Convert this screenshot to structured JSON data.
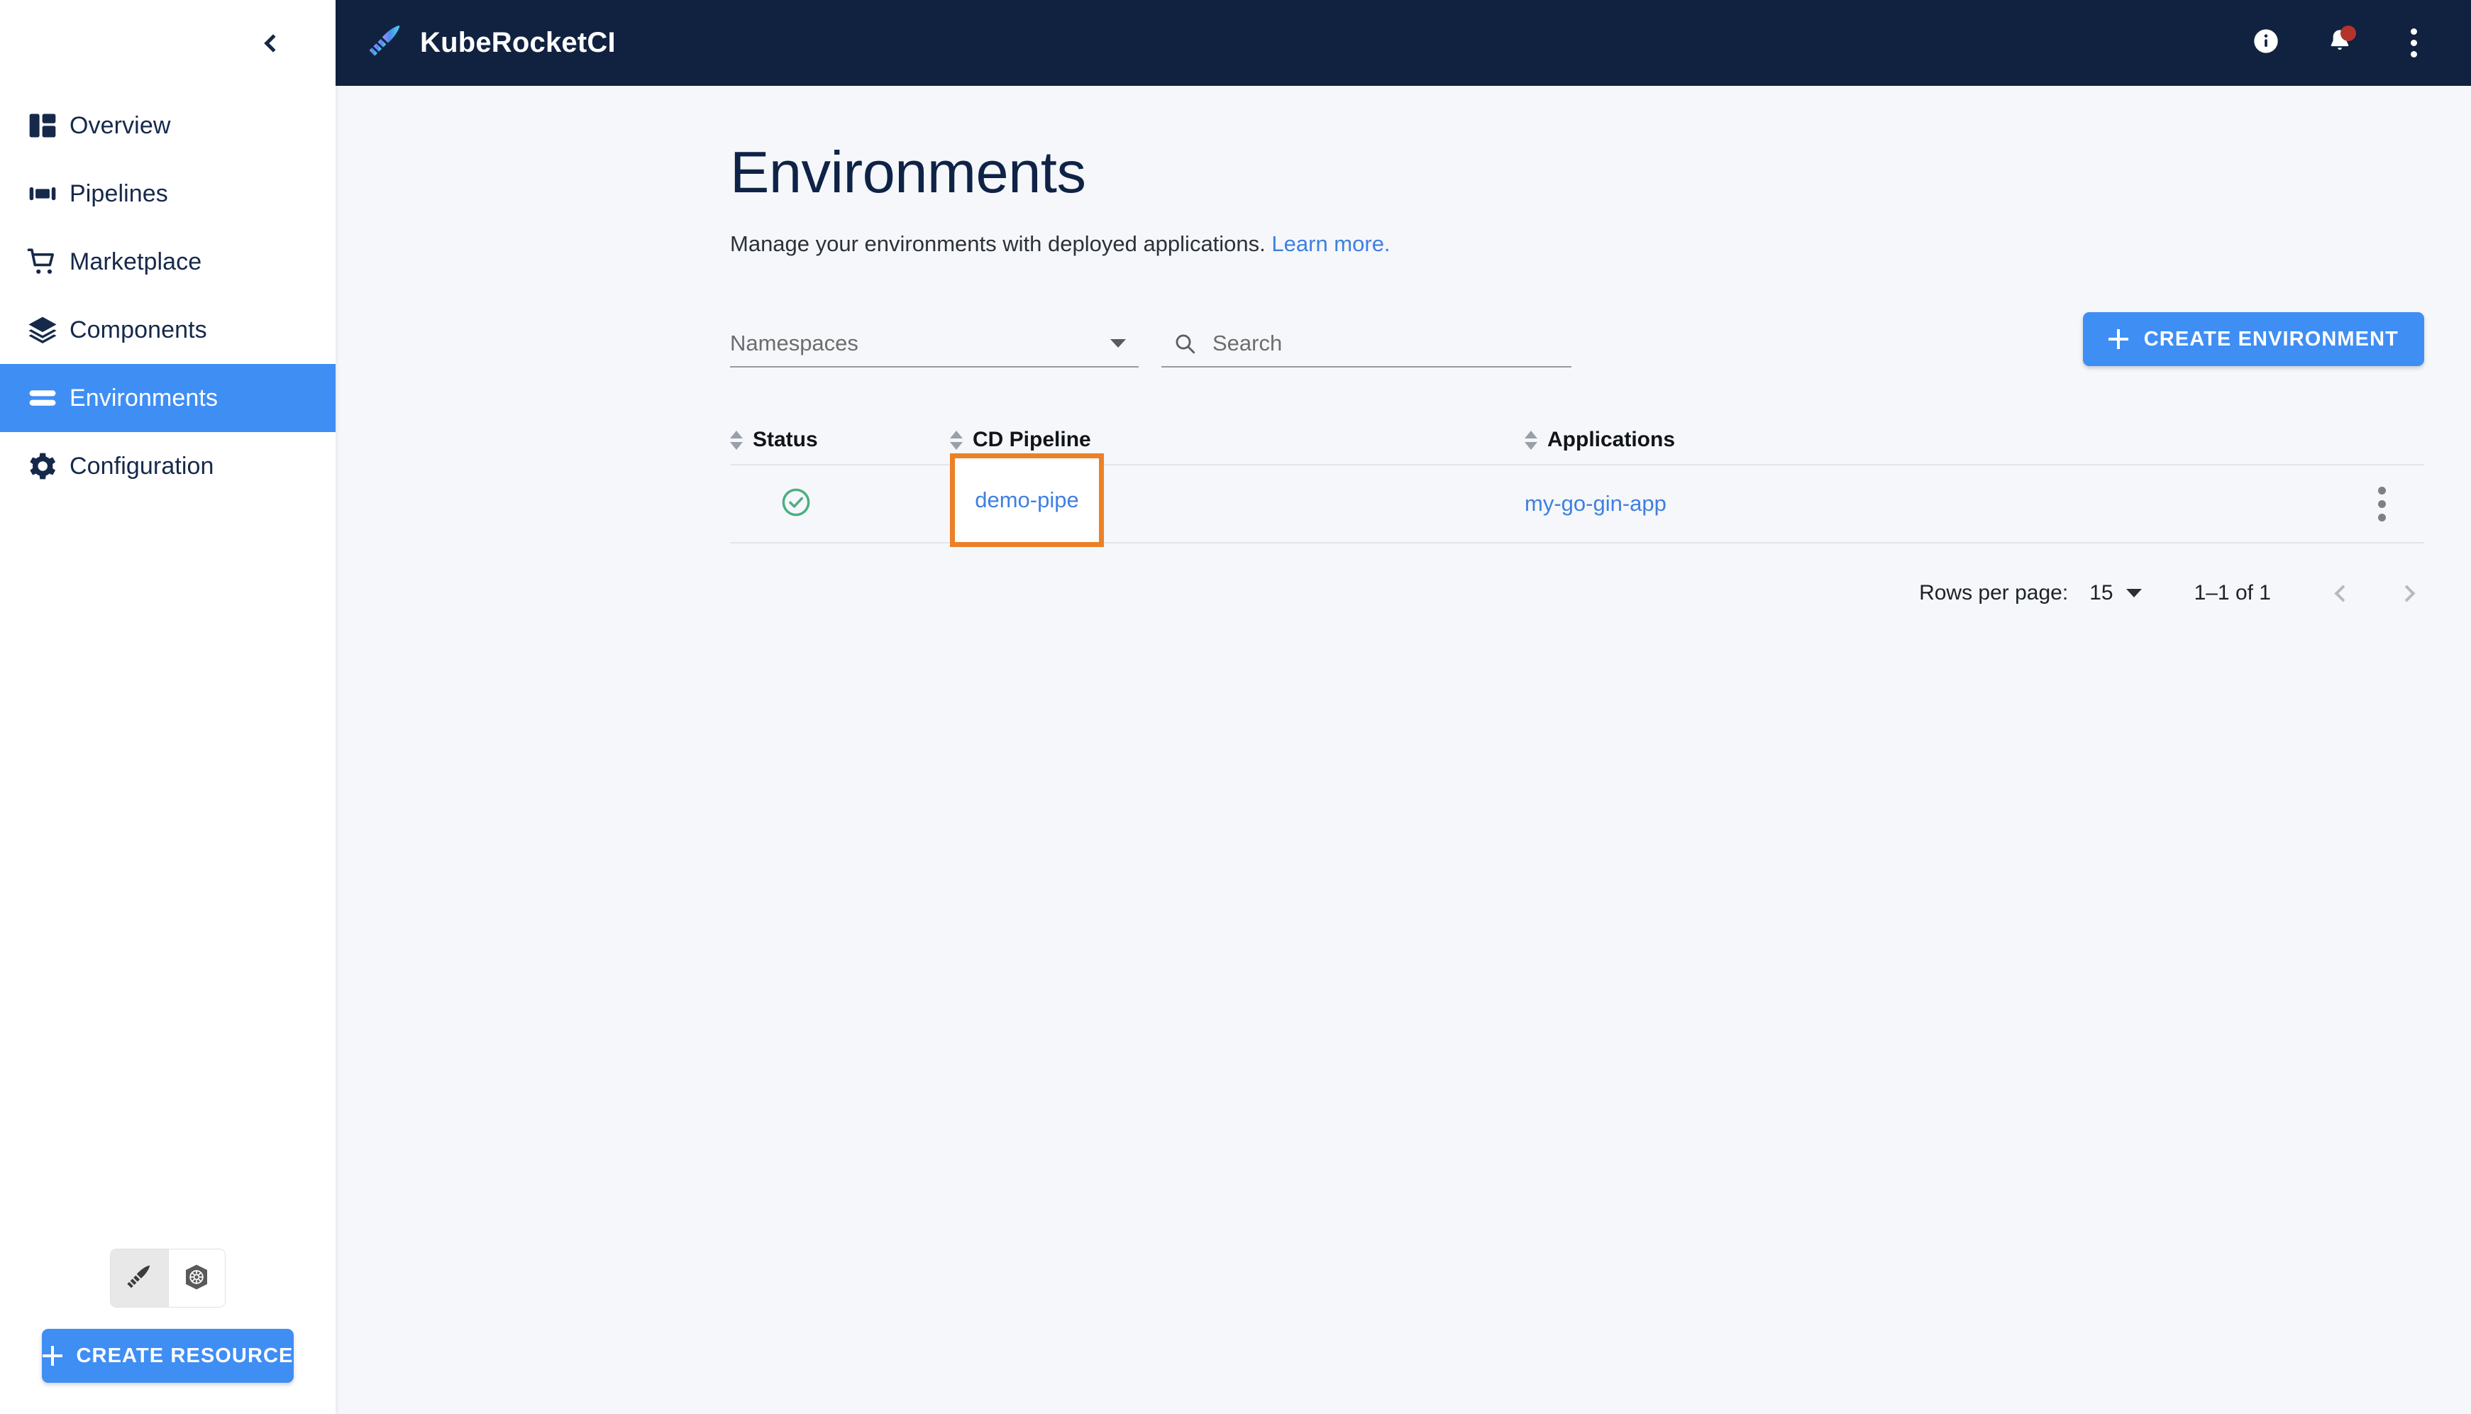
{
  "sidebar": {
    "collapse_label": "Collapse sidebar",
    "items": [
      {
        "label": "Overview",
        "icon": "dashboard-icon",
        "active": false
      },
      {
        "label": "Pipelines",
        "icon": "pipelines-icon",
        "active": false
      },
      {
        "label": "Marketplace",
        "icon": "cart-icon",
        "active": false
      },
      {
        "label": "Components",
        "icon": "layers-icon",
        "active": false
      },
      {
        "label": "Environments",
        "icon": "environments-icon",
        "active": true
      },
      {
        "label": "Configuration",
        "icon": "gear-icon",
        "active": false
      }
    ],
    "view_toggle": [
      {
        "name": "kuberocket-view",
        "icon": "rocket-feather-icon",
        "selected": true
      },
      {
        "name": "kubernetes-view",
        "icon": "kubernetes-helm-icon",
        "selected": false
      }
    ],
    "create_resource_label": "CREATE RESOURCE"
  },
  "topbar": {
    "brand": "KubeRocketCI",
    "logo_icon": "rocket-feather-icon",
    "actions": [
      {
        "name": "info-icon",
        "label": "Info"
      },
      {
        "name": "notifications-bell-icon",
        "label": "Notifications",
        "badge": true
      },
      {
        "name": "overflow-menu-icon",
        "label": "More options"
      }
    ]
  },
  "page": {
    "title": "Environments",
    "subtitle": "Manage your environments with deployed applications.",
    "learn_more": "Learn more."
  },
  "filters": {
    "namespaces_label": "Namespaces",
    "search_placeholder": "Search",
    "search_value": "",
    "create_environment_label": "CREATE ENVIRONMENT"
  },
  "table": {
    "columns": [
      {
        "key": "status",
        "label": "Status",
        "sortable": true
      },
      {
        "key": "cd_pipeline",
        "label": "CD Pipeline",
        "sortable": true
      },
      {
        "key": "applications",
        "label": "Applications",
        "sortable": true
      }
    ],
    "rows": [
      {
        "status": "healthy",
        "status_icon": "check-circle-icon",
        "cd_pipeline": "demo-pipe",
        "applications": "my-go-gin-app",
        "highlighted_cell": "cd_pipeline"
      }
    ]
  },
  "pagination": {
    "rows_per_page_label": "Rows per page:",
    "rows_per_page_value": "15",
    "range_label": "1–1 of 1",
    "prev_label": "Previous page",
    "next_label": "Next page"
  },
  "colors": {
    "accent_blue": "#3f8ef4",
    "link_blue": "#3f7fe0",
    "topbar_navy": "#112240",
    "highlight_orange": "#ec8027",
    "status_green": "#4cae80",
    "badge_red": "#b3342c",
    "content_bg": "#f5f7fb"
  }
}
